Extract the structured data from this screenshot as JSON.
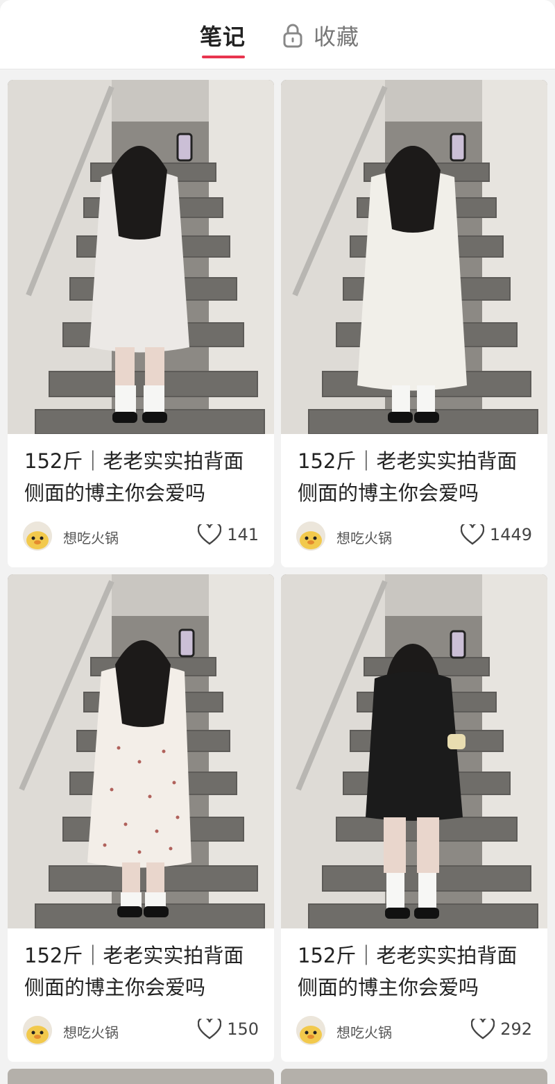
{
  "tabs": {
    "notes": "笔记",
    "favorites": "收藏"
  },
  "posts": [
    {
      "title": "152斤｜老老实实拍背面侧面的博主你会爱吗",
      "author": "想吃火锅",
      "likes": "141",
      "dress": "#ece9e6"
    },
    {
      "title": "152斤｜老老实实拍背面侧面的博主你会爱吗",
      "author": "想吃火锅",
      "likes": "1449",
      "dress": "#f1efe9"
    },
    {
      "title": "152斤｜老老实实拍背面侧面的博主你会爱吗",
      "author": "想吃火锅",
      "likes": "150",
      "dress": "#f3eee8"
    },
    {
      "title": "152斤｜老老实实拍背面侧面的博主你会爱吗",
      "author": "想吃火锅",
      "likes": "292",
      "dress": "#1b1b1b"
    }
  ],
  "colors": {
    "accent": "#e8344e"
  }
}
